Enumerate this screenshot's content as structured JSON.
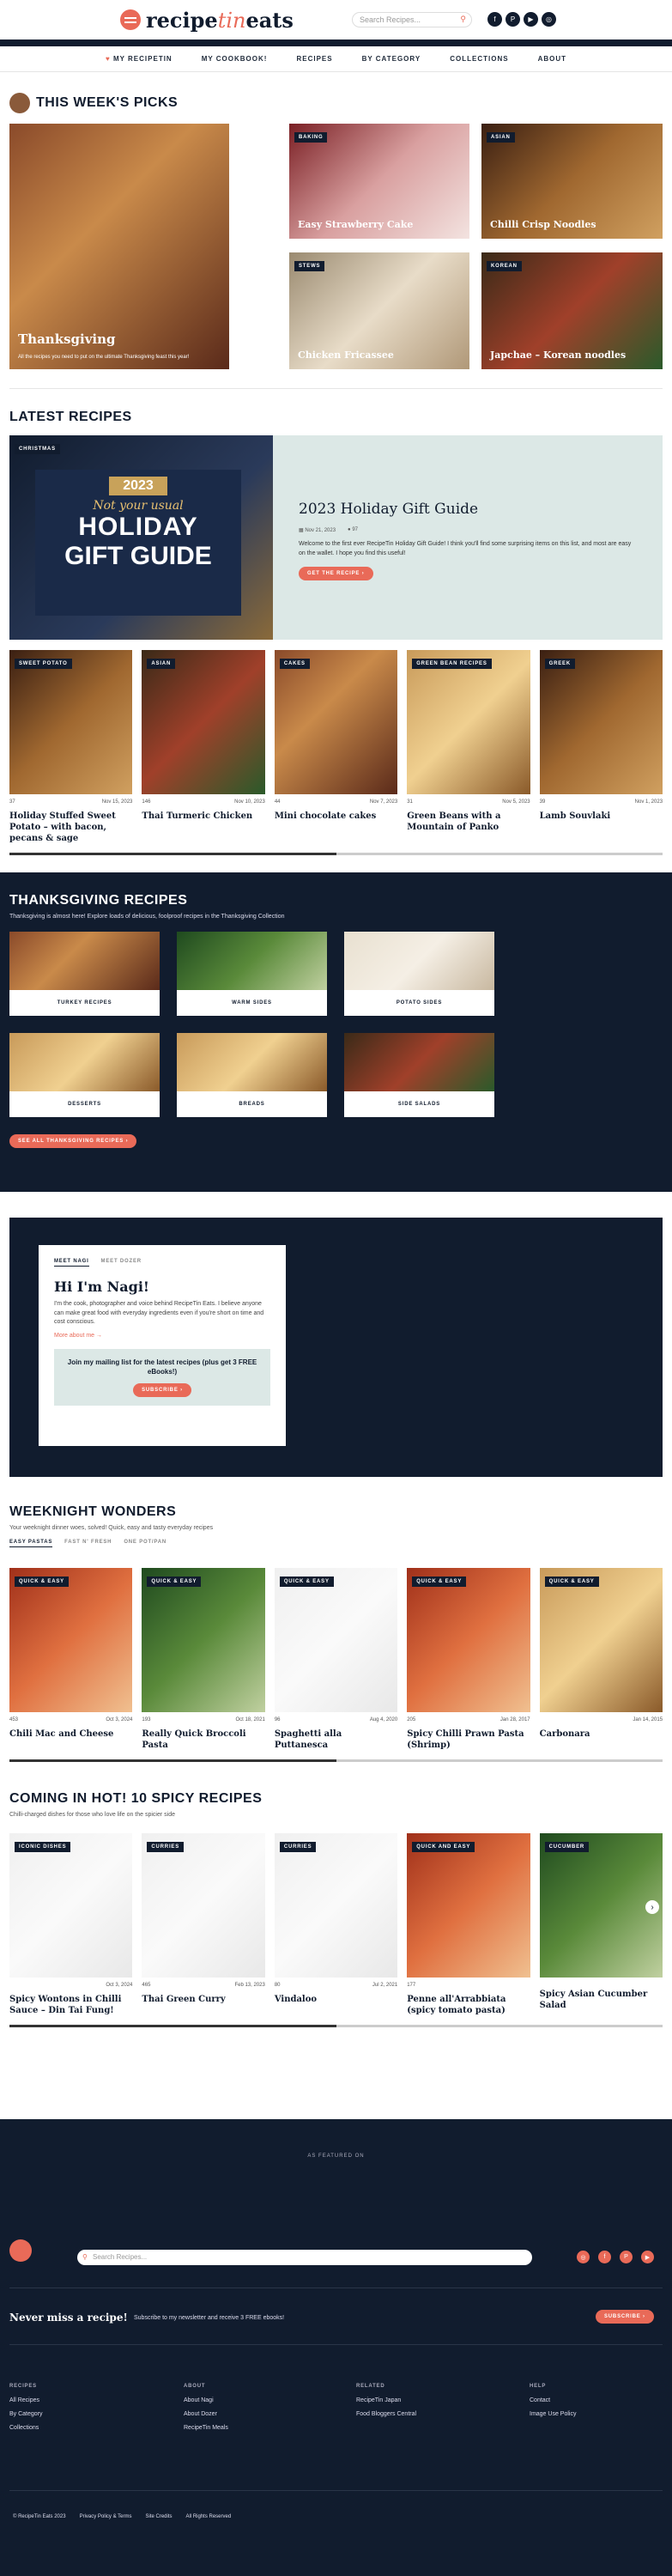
{
  "header": {
    "logo_main": "recipe",
    "logo_accent": "tin",
    "logo_end": "eats",
    "search_placeholder": "Search Recipes...",
    "social": [
      "f",
      "P",
      "▶",
      "◎"
    ]
  },
  "nav": [
    "MY RECIPETIN",
    "MY COOKBOOK!",
    "RECIPES",
    "BY CATEGORY",
    "COLLECTIONS",
    "ABOUT"
  ],
  "picks": {
    "title": "THIS WEEK'S PICKS",
    "hero_caption": "Thanksgiving",
    "hero_sub": "All the recipes you need to put on the ultimate Thanksgiving feast this year!",
    "items": [
      {
        "tag": "BAKING",
        "caption": "Easy Strawberry Cake"
      },
      {
        "tag": "ASIAN",
        "caption": "Chilli Crisp Noodles"
      },
      {
        "tag": "STEWS",
        "caption": "Chicken Fricassee"
      },
      {
        "tag": "KOREAN",
        "caption": "Japchae – Korean noodles"
      }
    ]
  },
  "latest": {
    "title": "LATEST RECIPES",
    "feature_tag": "CHRISTMAS",
    "feature_year": "2023",
    "feature_script": "Not your usual",
    "feature_big1": "HOLIDAY",
    "feature_big2": "GIFT GUIDE",
    "feature_title": "2023 Holiday Gift Guide",
    "feature_date": "Nov 21, 2023",
    "feature_comments": "97",
    "feature_desc": "Welcome to the first ever RecipeTin Holiday Gift Guide! I think you'll find some surprising items on this list, and most are easy on the wallet. I hope you find this useful!",
    "feature_btn": "GET THE RECIPE",
    "items": [
      {
        "tag": "SWEET POTATO",
        "comments": "37",
        "date": "Nov 15, 2023",
        "title": "Holiday Stuffed Sweet Potato – with bacon, pecans & sage"
      },
      {
        "tag": "ASIAN",
        "comments": "146",
        "date": "Nov 10, 2023",
        "title": "Thai Turmeric Chicken"
      },
      {
        "tag": "CAKES",
        "comments": "44",
        "date": "Nov 7, 2023",
        "title": "Mini chocolate cakes"
      },
      {
        "tag": "GREEN BEAN RECIPES",
        "comments": "31",
        "date": "Nov 5, 2023",
        "title": "Green Beans with a Mountain of Panko"
      },
      {
        "tag": "GREEK",
        "comments": "39",
        "date": "Nov 1, 2023",
        "title": "Lamb Souvlaki"
      }
    ]
  },
  "thanksgiving": {
    "title": "THANKSGIVING RECIPES",
    "sub": "Thanksgiving is almost here! Explore loads of delicious, foolproof recipes in the Thanksgiving Collection",
    "cards": [
      "TURKEY RECIPES",
      "WARM SIDES",
      "POTATO SIDES",
      "DESSERTS",
      "BREADS",
      "SIDE SALADS"
    ],
    "btn": "SEE ALL THANKSGIVING RECIPES"
  },
  "about": {
    "tab1": "MEET NAGI",
    "tab2": "MEET DOZER",
    "heading": "Hi I'm Nagi!",
    "text": "I'm the cook, photographer and voice behind RecipeTin Eats. I believe anyone can make great food with everyday ingredients even if you're short on time and cost conscious.",
    "more": "More about me →",
    "mail_text": "Join my mailing list for the latest recipes (plus get 3 FREE eBooks!)",
    "mail_btn": "SUBSCRIBE"
  },
  "weeknight": {
    "title": "WEEKNIGHT WONDERS",
    "sub": "Your weeknight dinner woes, solved! Quick, easy and tasty everyday recipes",
    "tabs": [
      "EASY PASTAS",
      "FAST N' FRESH",
      "ONE POT/PAN"
    ],
    "items": [
      {
        "tag": "QUICK & EASY",
        "comments": "453",
        "date": "Oct 3, 2024",
        "title": "Chili Mac and Cheese"
      },
      {
        "tag": "QUICK & EASY",
        "comments": "193",
        "date": "Oct 18, 2021",
        "title": "Really Quick Broccoli Pasta"
      },
      {
        "tag": "QUICK & EASY",
        "comments": "96",
        "date": "Aug 4, 2020",
        "title": "Spaghetti alla Puttanesca"
      },
      {
        "tag": "QUICK & EASY",
        "comments": "205",
        "date": "Jan 28, 2017",
        "title": "Spicy Chilli Prawn Pasta (Shrimp)"
      },
      {
        "tag": "QUICK & EASY",
        "comments": "",
        "date": "Jan 14, 2015",
        "title": "Carbonara"
      }
    ]
  },
  "spicy": {
    "title": "COMING IN HOT! 10 SPICY RECIPES",
    "sub": "Chilli-charged dishes for those who love life on the spicier side",
    "items": [
      {
        "tag": "ICONIC DISHES",
        "comments": "",
        "date": "Oct 3, 2024",
        "title": "Spicy Wontons in Chilli Sauce – Din Tai Fung!"
      },
      {
        "tag": "CURRIES",
        "comments": "465",
        "date": "Feb 13, 2023",
        "title": "Thai Green Curry"
      },
      {
        "tag": "CURRIES",
        "comments": "80",
        "date": "Jul 2, 2021",
        "title": "Vindaloo"
      },
      {
        "tag": "QUICK AND EASY",
        "comments": "177",
        "date": "",
        "title": "Penne all'Arrabbiata (spicy tomato pasta)"
      },
      {
        "tag": "CUCUMBER",
        "comments": "",
        "date": "",
        "title": "Spicy Asian Cucumber Salad"
      }
    ]
  },
  "footer": {
    "featured": "AS FEATURED ON",
    "search_placeholder": "Search Recipes...",
    "social": [
      "◎",
      "f",
      "P",
      "▶"
    ],
    "never_miss": "Never miss a recipe!",
    "never_text": "Subscribe to my newsletter and receive 3 FREE ebooks!",
    "subscribe": "SUBSCRIBE",
    "cols": [
      {
        "h": "RECIPES",
        "links": [
          "All Recipes",
          "By Category",
          "Collections"
        ]
      },
      {
        "h": "ABOUT",
        "links": [
          "About Nagi",
          "About Dozer",
          "RecipeTin Meals"
        ]
      },
      {
        "h": "RELATED",
        "links": [
          "RecipeTin Japan",
          "Food Bloggers Central"
        ]
      },
      {
        "h": "HELP",
        "links": [
          "Contact",
          "Image Use Policy"
        ]
      }
    ],
    "bottom": [
      "© RecipeTin Eats 2023",
      "Privacy Policy & Terms",
      "Site Credits",
      "All Rights Reserved"
    ]
  },
  "colors": {
    "navy": "#111c2e",
    "coral": "#e96a58",
    "mint": "#dce8e6"
  }
}
